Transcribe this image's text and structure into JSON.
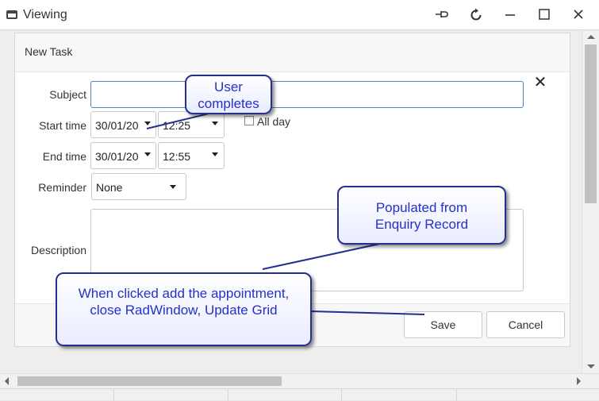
{
  "window": {
    "title": "Viewing",
    "icons": [
      "window-icon",
      "pin-icon",
      "reload-icon",
      "minimize-icon",
      "maximize-icon",
      "close-icon"
    ]
  },
  "dialog": {
    "title": "New Task",
    "subject": {
      "label": "Subject",
      "value": ""
    },
    "start_time": {
      "label": "Start time",
      "date": "30/01/20",
      "time": "12:25"
    },
    "all_day": {
      "label": "All day",
      "checked": false
    },
    "end_time": {
      "label": "End time",
      "date": "30/01/20",
      "time": "12:55"
    },
    "reminder": {
      "label": "Reminder",
      "value": "None"
    },
    "description": {
      "label": "Description",
      "value": ""
    },
    "save_label": "Save",
    "cancel_label": "Cancel"
  },
  "callouts": {
    "user_completes": "User completes",
    "populated": "Populated from Enquiry Record",
    "save_note": "When clicked add the appointment, close RadWindow, Update Grid"
  },
  "colors": {
    "callout_text": "#2430c8",
    "callout_border": "#23308f",
    "focus_border": "#4a86c5"
  }
}
